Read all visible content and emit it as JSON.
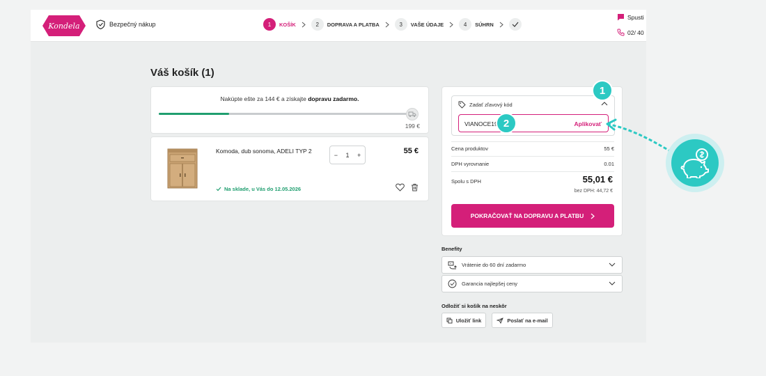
{
  "brand": {
    "logo_text": "Kondela",
    "accent": "#d41f79",
    "success": "#1f9e6f",
    "annotation": "#2cc9c3"
  },
  "header": {
    "secure_label": "Bezpečný nákup",
    "steps": [
      {
        "num": "1",
        "label": "Košík",
        "active": true
      },
      {
        "num": "2",
        "label": "Doprava a platba",
        "active": false
      },
      {
        "num": "3",
        "label": "Vaše údaje",
        "active": false
      },
      {
        "num": "4",
        "label": "Súhrn",
        "active": false
      }
    ],
    "contact_chat": "Spusti",
    "contact_phone": "02/ 40"
  },
  "cart": {
    "title": "Váš košík (1)",
    "shipping_prefix": "Nakúpte ešte za 144 € a získajte",
    "shipping_bold": "dopravu zadarmo.",
    "shipping_progress": 0.28,
    "shipping_threshold": "199 €",
    "item": {
      "name": "Komoda, dub sonoma, ADELI TYP 2",
      "quantity": "1",
      "price": "55 €",
      "stock": "Na sklade, u Vás do 12.05.2026"
    }
  },
  "summary": {
    "coupon_label": "Zadať zľavový kód",
    "coupon_value": "VIANOCE19",
    "apply_label": "Aplikovať",
    "rows": [
      {
        "label": "Cena produktov",
        "value": "55 €"
      },
      {
        "label": "DPH vyrovnanie",
        "value": "0.01"
      }
    ],
    "total_label": "Spolu s DPH",
    "total_value": "55,01 €",
    "vat_note": "bez DPH: 44,72 €",
    "cta_label": "Pokračovať na dopravu a platbu"
  },
  "benefits": {
    "title": "Benefity",
    "items": [
      "Vrátenie do 60 dní zadarmo",
      "Garancia najlepšej ceny"
    ]
  },
  "save": {
    "title": "Odložiť si košík na neskôr",
    "link_label": "Uložiť link",
    "email_label": "Poslať na e-mail"
  },
  "annotations": {
    "step1": "1",
    "step2": "2"
  }
}
